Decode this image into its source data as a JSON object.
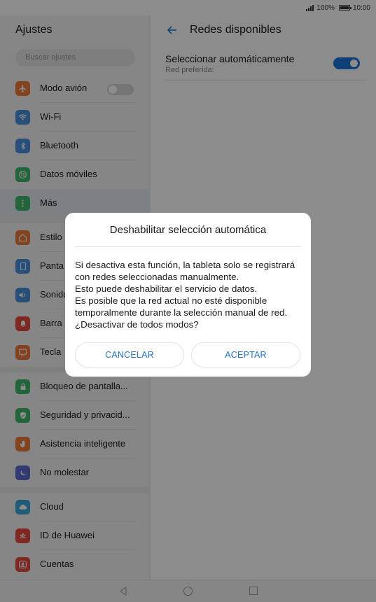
{
  "statusbar": {
    "battery": "100%",
    "time": "10:00"
  },
  "left": {
    "title": "Ajustes",
    "search_placeholder": "Buscar ajustes",
    "items": [
      {
        "label": "Modo avión",
        "icon": "airplane-icon",
        "color": "#f07a3a"
      },
      {
        "label": "Wi-Fi",
        "icon": "wifi-icon",
        "color": "#4a90d9"
      },
      {
        "label": "Bluetooth",
        "icon": "bluetooth-icon",
        "color": "#4a90d9"
      },
      {
        "label": "Datos móviles",
        "icon": "mobile-data-icon",
        "color": "#3eb86a"
      },
      {
        "label": "Más",
        "icon": "more-icon",
        "color": "#3eb86a"
      },
      {
        "label": "Estilo",
        "icon": "home-style-icon",
        "color": "#f07a3a"
      },
      {
        "label": "Panta",
        "icon": "display-icon",
        "color": "#4a90d9"
      },
      {
        "label": "Sonido",
        "icon": "sound-icon",
        "color": "#4a90d9"
      },
      {
        "label": "Barra",
        "icon": "notification-bar-icon",
        "color": "#e84a3e"
      },
      {
        "label": "Tecla",
        "icon": "navigation-key-icon",
        "color": "#f07a3a"
      },
      {
        "label": "Bloqueo de pantalla...",
        "icon": "lock-icon",
        "color": "#3eb86a"
      },
      {
        "label": "Seguridad y privacid...",
        "icon": "shield-icon",
        "color": "#3eb86a"
      },
      {
        "label": "Asistencia inteligente",
        "icon": "hand-icon",
        "color": "#f07a3a"
      },
      {
        "label": "No molestar",
        "icon": "moon-icon",
        "color": "#5b6ccf"
      },
      {
        "label": "Cloud",
        "icon": "cloud-icon",
        "color": "#3aa8d9"
      },
      {
        "label": "ID de Huawei",
        "icon": "huawei-icon",
        "color": "#e84a3e"
      },
      {
        "label": "Cuentas",
        "icon": "account-icon",
        "color": "#e84a3e"
      }
    ]
  },
  "right": {
    "title": "Redes disponibles",
    "auto_select": {
      "title": "Seleccionar automáticamente",
      "subtitle": "Red preferida:"
    }
  },
  "dialog": {
    "title": "Deshabilitar selección automática",
    "body_lines": [
      "Si desactiva esta función, la tableta solo se registrará con redes seleccionadas manualmente.",
      "Esto puede deshabilitar el servicio de datos.",
      "Es posible que la red actual no esté disponible temporalmente durante la selección manual de red.",
      "¿Desactivar de todos modos?"
    ],
    "cancel_label": "CANCELAR",
    "accept_label": "ACEPTAR"
  },
  "colors": {
    "accent": "#1a73d9"
  }
}
